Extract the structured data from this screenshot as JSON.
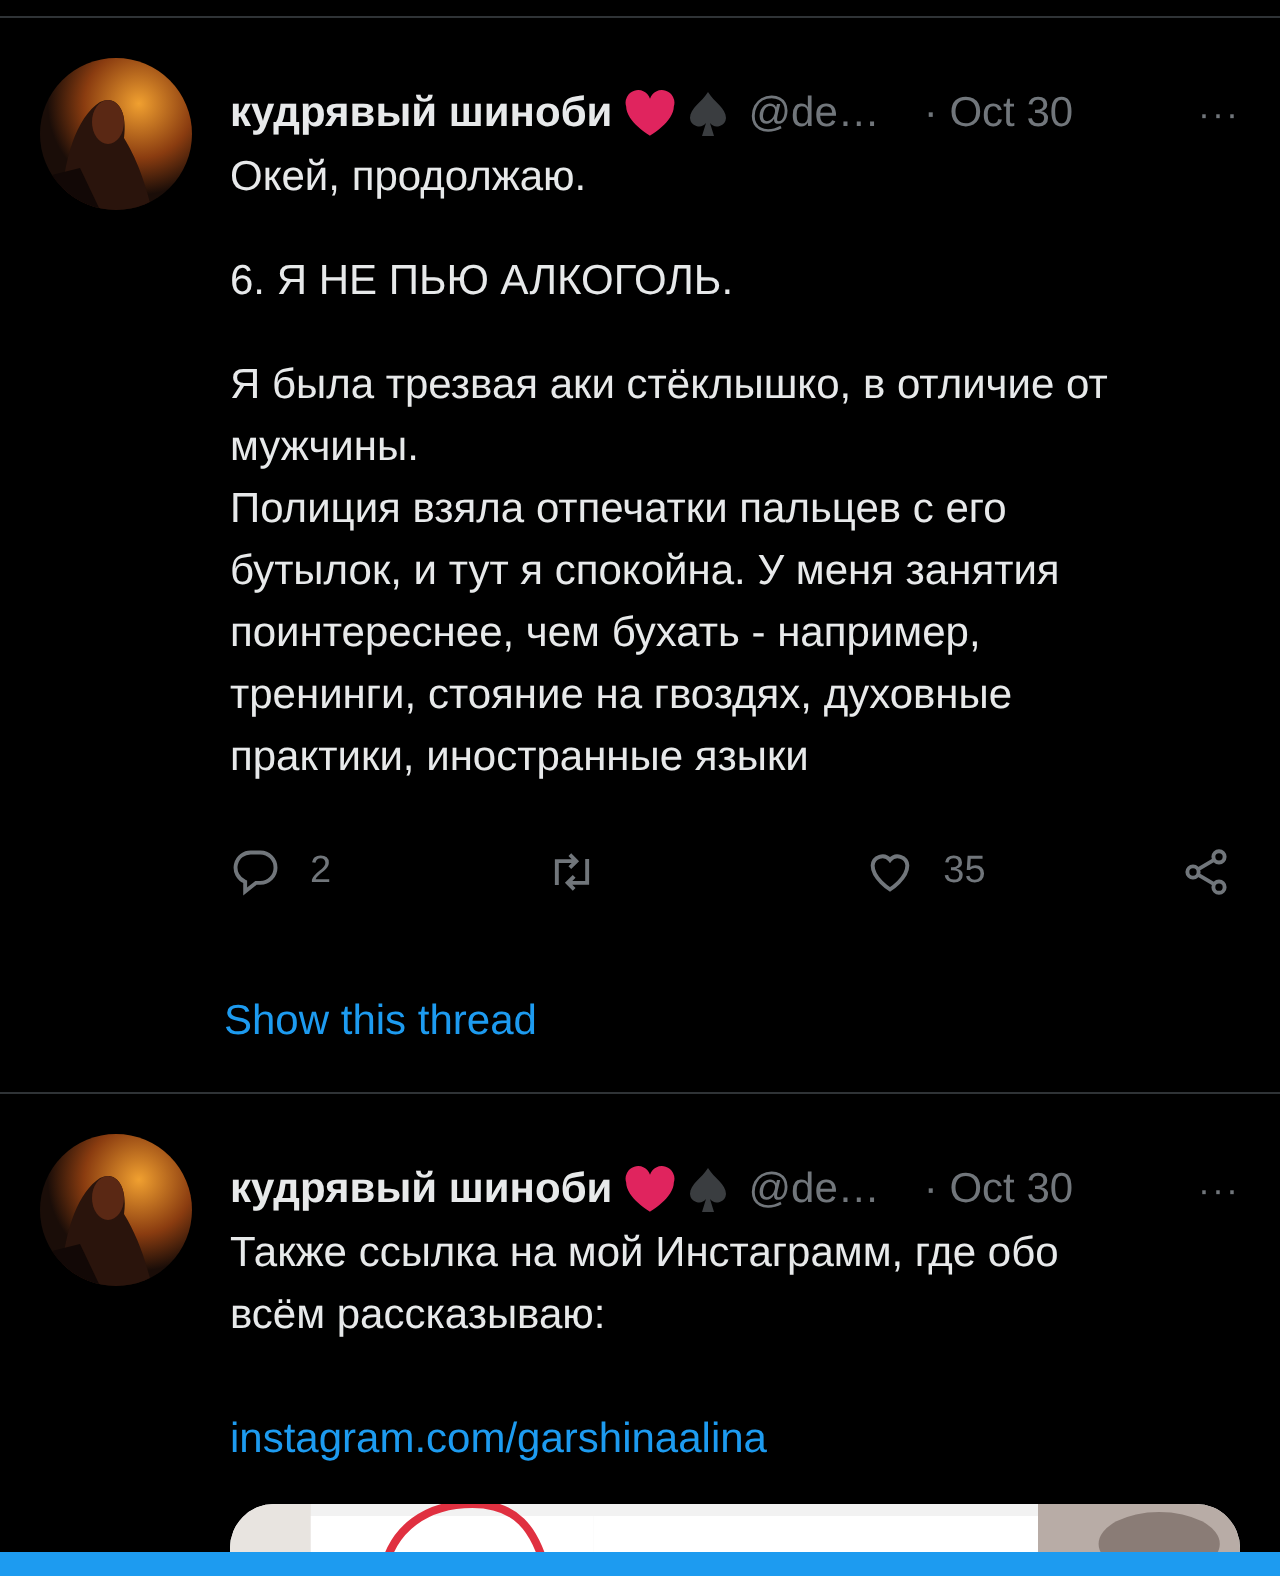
{
  "tweets": [
    {
      "name": "кудрявый шиноби",
      "handle": "@de…",
      "time": "· Oct 30",
      "more": "···",
      "paragraphs": [
        "Окей, продолжаю.",
        "6. Я НЕ ПЬЮ АЛКОГОЛЬ.",
        "Я была трезвая аки стёклышко, в отличие от\nмужчины.\nПолиция взяла отпечатки пальцев с его\nбутылок, и тут я спокойна. У меня занятия\nпоинтереснее, чем бухать - например,\nтренинги, стояние на гвоздях, духовные\nпрактики, иностранные языки"
      ],
      "actions": [
        {
          "kind": "reply",
          "count": "2"
        },
        {
          "kind": "retweet"
        },
        {
          "kind": "like",
          "count": "35"
        },
        {
          "kind": "share"
        }
      ],
      "thread_link": "Show this thread"
    },
    {
      "name": "кудрявый шиноби",
      "handle": "@de…",
      "time": "· Oct 30",
      "more": "···",
      "paragraphs": [
        "Также ссылка на мой Инстаграмм, где обо\nвсём рассказываю:"
      ],
      "link": "instagram.com/garshinaalina",
      "media": {
        "kind": "picture"
      }
    }
  ]
}
